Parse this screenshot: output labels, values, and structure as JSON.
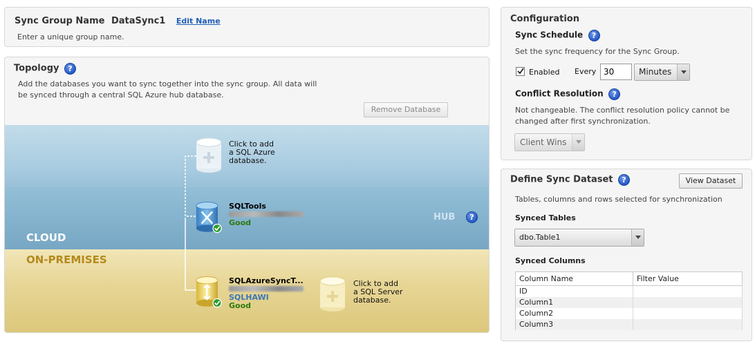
{
  "sync_group": {
    "label": "Sync Group Name",
    "name": "DataSync1",
    "edit_link": "Edit Name",
    "hint": "Enter a unique group name."
  },
  "topology": {
    "title": "Topology",
    "help": "?",
    "description_line1": "Add the databases you want to sync together into the sync group. All data will",
    "description_line2": "be synced through a central SQL Azure hub database.",
    "remove_button": "Remove Database",
    "cloud_label": "CLOUD",
    "onprem_label": "ON-PREMISES",
    "hub_label": "HUB",
    "add_azure": [
      "Click to add",
      "a SQL Azure",
      "database."
    ],
    "hub_db": {
      "name": "SQLTools",
      "status": "Good"
    },
    "member_db": {
      "name": "SQLAzureSyncT...",
      "agent": "SQLHAWI",
      "status": "Good"
    },
    "add_server": [
      "Click to add",
      "a SQL Server",
      "database."
    ]
  },
  "configuration": {
    "title": "Configuration",
    "schedule_title": "Sync Schedule",
    "schedule_desc": "Set the sync frequency for the Sync Group.",
    "enabled_label": "Enabled",
    "every_label": "Every",
    "every_value": "30",
    "unit_value": "Minutes",
    "conflict_title": "Conflict Resolution",
    "conflict_desc_line1": "Not changeable. The conflict resolution policy cannot be",
    "conflict_desc_line2": "changed after first synchronization.",
    "conflict_value": "Client Wins"
  },
  "dataset": {
    "title": "Define Sync Dataset",
    "view_button": "View Dataset",
    "desc": "Tables, columns and rows selected for synchronization",
    "synced_tables_label": "Synced Tables",
    "table_value": "dbo.Table1",
    "synced_columns_label": "Synced Columns",
    "col_header_name": "Column Name",
    "col_header_filter": "Filter Value",
    "columns": [
      "ID",
      "Column1",
      "Column2",
      "Column3"
    ]
  }
}
